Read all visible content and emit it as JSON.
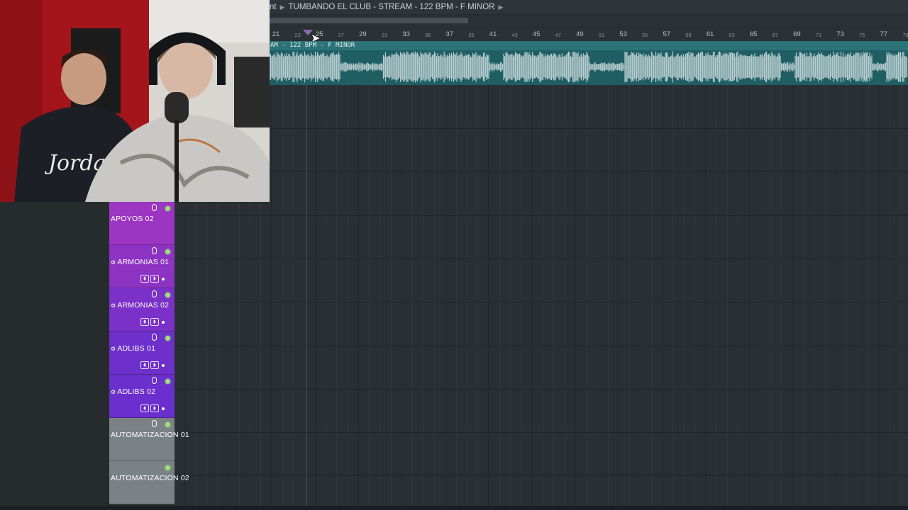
{
  "breadcrumb": {
    "prefix": "nt",
    "title": "TUMBANDO EL CLUB - STREAM - 122 BPM - F MINOR"
  },
  "ruler": {
    "major": [
      "21",
      "25",
      "29",
      "33",
      "37",
      "41",
      "45",
      "49",
      "53",
      "57",
      "61",
      "65",
      "69",
      "73",
      "77"
    ],
    "minor": [
      "23",
      "27",
      "31",
      "35",
      "39",
      "43",
      "47",
      "51",
      "55",
      "59",
      "63",
      "67",
      "71",
      "75",
      "79"
    ]
  },
  "clip": {
    "label": "AM - 122 BPM - F MINOR"
  },
  "tracks": [
    {
      "name": "APOYOS 02",
      "color": "#9b35c2",
      "has_cog": false,
      "has_controls": false
    },
    {
      "name": "ARMONIAS 01",
      "color": "#8c33c4",
      "has_cog": true,
      "has_controls": true
    },
    {
      "name": "ARMONIAS 02",
      "color": "#7b31c8",
      "has_cog": true,
      "has_controls": true
    },
    {
      "name": "ADLIBS 01",
      "color": "#6d30ca",
      "has_cog": true,
      "has_controls": true
    },
    {
      "name": "ADLIBS 02",
      "color": "#6a2fcc",
      "has_cog": true,
      "has_controls": true
    },
    {
      "name": "AUTOMATIZACION 01",
      "color": "#7a8286",
      "has_cog": false,
      "has_controls": false
    },
    {
      "name": "AUTOMATIZACION 02",
      "color": "#7a8286",
      "has_cog": false,
      "has_controls": false
    }
  ],
  "colors": {
    "grid_bg": "#2a2f33",
    "clip_bg": "#1f5f63",
    "waveform": "#b9cdd0",
    "led_green": "#9de07a"
  },
  "icons": {
    "mic": "microphone-icon",
    "led": "led-indicator-icon",
    "arrow": "chevron-right-icon"
  }
}
